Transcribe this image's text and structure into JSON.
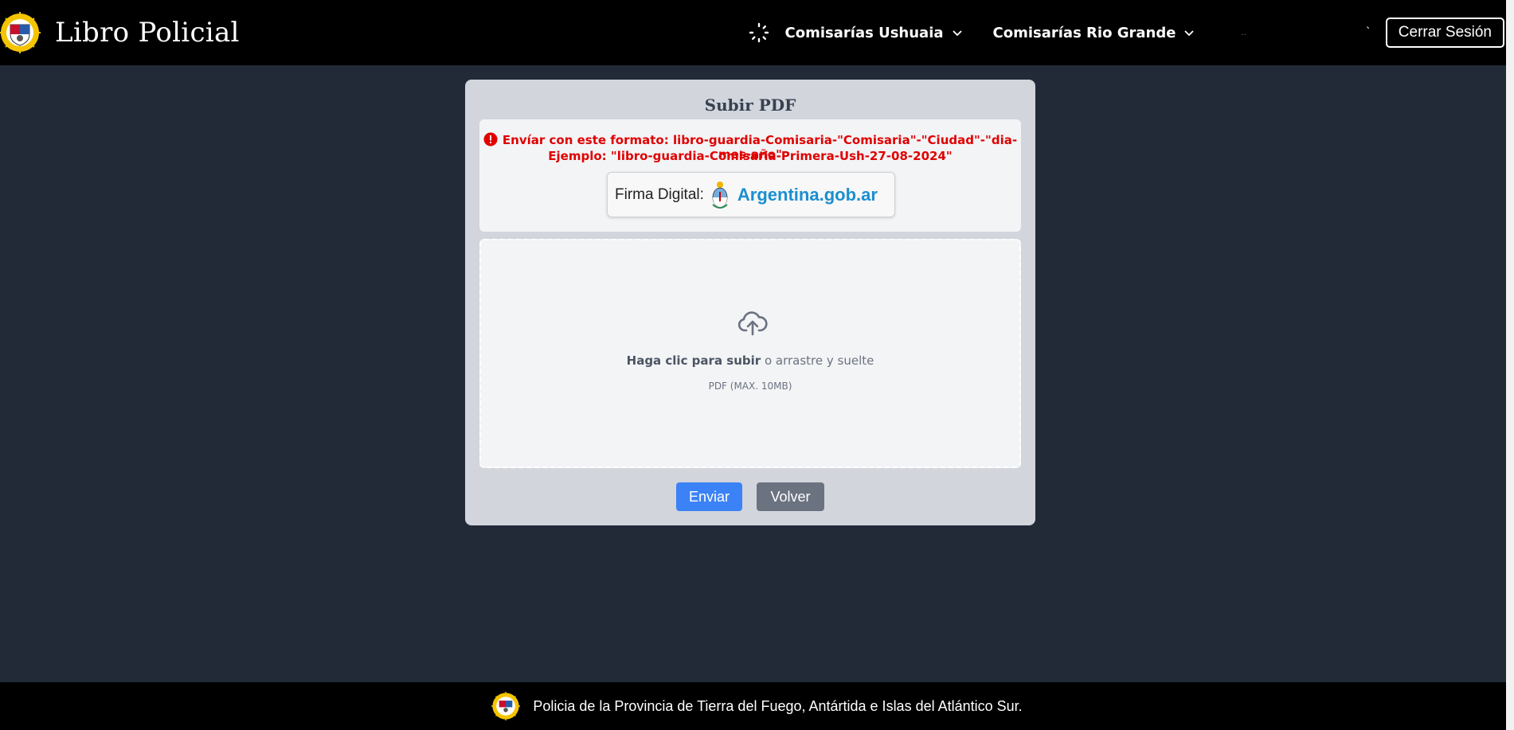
{
  "header": {
    "title": "Libro Policial",
    "menus": [
      {
        "label": "Comisarías Ushuaia"
      },
      {
        "label": "Comisarías Rio Grande"
      }
    ],
    "dots": "..",
    "tick": "`",
    "logout_label": "Cerrar Sesión"
  },
  "card": {
    "title": "Subir PDF",
    "format_line": "Envíar con este formato: libro-guardia-Comisaria-\"Comisaria\"-\"Ciudad\"-\"dia-mes-año\"",
    "example_line": "Ejemplo: \"libro-guardia-Comisaria-Primera-Ush-27-08-2024\"",
    "firma_label": "Firma Digital:",
    "gob_link": "Argentina.gob.ar",
    "dropzone": {
      "click_text": "Haga clic para subir",
      "drag_text": " o arrastre y suelte",
      "hint": "PDF (MAX. 10MB)"
    },
    "send_label": "Enviar",
    "back_label": "Volver"
  },
  "footer": {
    "text": "Policia de la Provincia de Tierra del Fuego, Antártida e Islas del Atlántico Sur."
  },
  "colors": {
    "navbar": "#000000",
    "background": "#222a38",
    "card": "#d2d5dc",
    "error": "#e00000",
    "primary": "#3b82f6",
    "secondary": "#6b7280",
    "link": "#1a8fd0"
  },
  "icons": {
    "logo": "police-sun-shield-icon",
    "spinner": "loading-spinner-icon",
    "chevron": "chevron-down-icon",
    "alert": "alert-circle-icon",
    "escudo": "argentina-coat-of-arms-icon",
    "upload": "cloud-upload-icon"
  }
}
